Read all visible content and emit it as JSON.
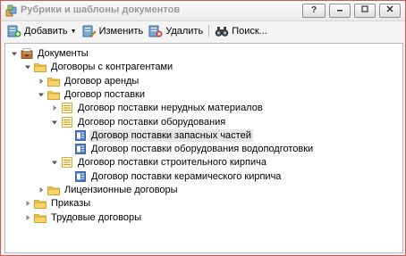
{
  "window": {
    "title": "Рубрики и шаблоны документов",
    "help_label": "?"
  },
  "toolbar": {
    "add_label": "Добавить",
    "edit_label": "Изменить",
    "delete_label": "Удалить",
    "search_label": "Поиск..."
  },
  "tree": [
    {
      "label": "Документы",
      "level": 0,
      "icon": "cabinet-icon",
      "state": "expanded"
    },
    {
      "label": "Договоры с контрагентами",
      "level": 1,
      "icon": "folder-icon",
      "state": "expanded"
    },
    {
      "label": "Договор аренды",
      "level": 2,
      "icon": "folder-icon",
      "state": "collapsed"
    },
    {
      "label": "Договор поставки",
      "level": 2,
      "icon": "folder-icon",
      "state": "expanded"
    },
    {
      "label": "Договор поставки нерудных материалов",
      "level": 3,
      "icon": "rubric-icon",
      "state": "collapsed"
    },
    {
      "label": "Договор поставки оборудования",
      "level": 3,
      "icon": "rubric-icon",
      "state": "expanded"
    },
    {
      "label": "Договор поставки запасных частей",
      "level": 4,
      "icon": "template-icon",
      "state": "leaf",
      "selected": true
    },
    {
      "label": "Договор поставки оборудования водоподготовки",
      "level": 4,
      "icon": "template-icon",
      "state": "leaf"
    },
    {
      "label": "Договор поставки строительного кирпича",
      "level": 3,
      "icon": "rubric-icon",
      "state": "expanded"
    },
    {
      "label": "Договор поставки керамического кирпича",
      "level": 4,
      "icon": "template-icon",
      "state": "leaf"
    },
    {
      "label": "Лицензионные договоры",
      "level": 2,
      "icon": "folder-icon",
      "state": "collapsed"
    },
    {
      "label": "Приказы",
      "level": 1,
      "icon": "folder-icon",
      "state": "collapsed"
    },
    {
      "label": "Трудовые договоры",
      "level": 1,
      "icon": "folder-icon",
      "state": "collapsed"
    }
  ],
  "colors": {
    "window_border": "#d4574e",
    "folder": "#f2c94c",
    "rubric": "#f2c94c",
    "template": "#4a78c2",
    "selected_bg": "#e6e6e6"
  }
}
